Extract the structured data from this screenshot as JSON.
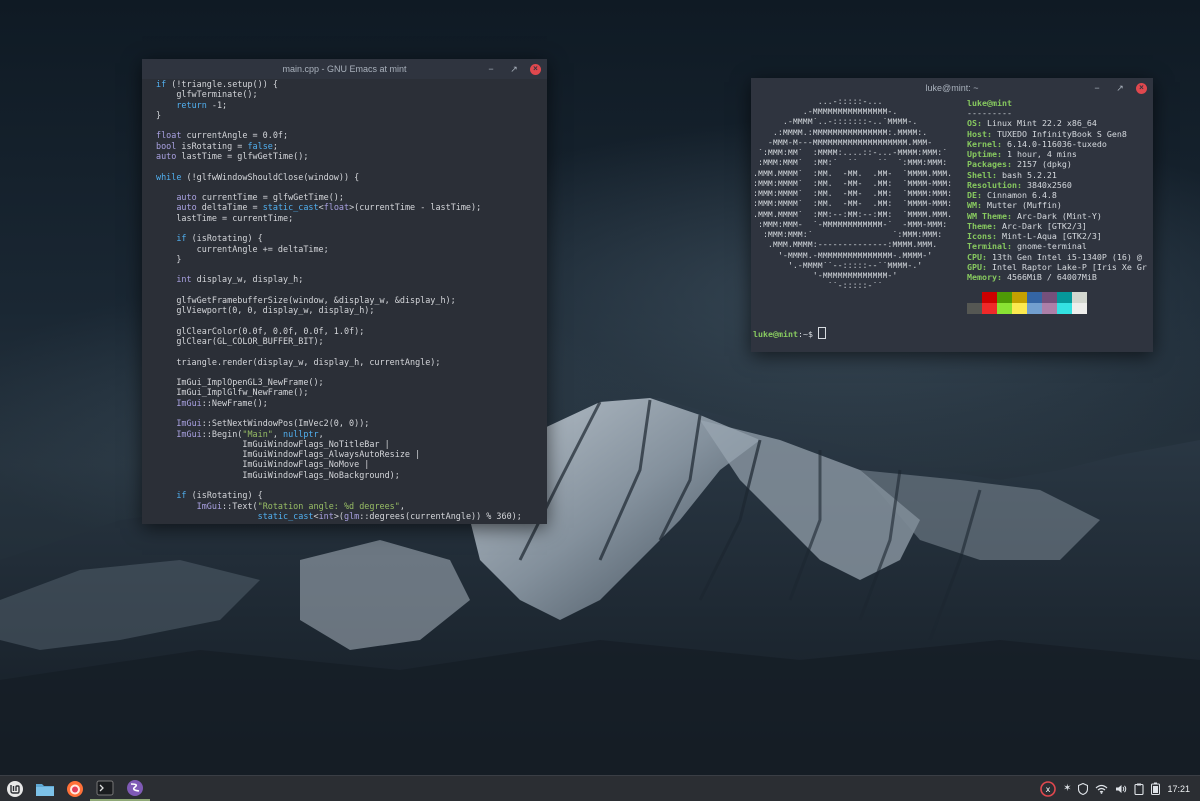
{
  "emacs": {
    "title": "main.cpp - GNU Emacs at mint"
  },
  "terminal": {
    "title": "luke@mint: ~",
    "user_host": "luke@mint",
    "separator": "---------",
    "info": [
      {
        "key": "OS",
        "value": "Linux Mint 22.2 x86_64"
      },
      {
        "key": "Host",
        "value": "TUXEDO InfinityBook S Gen8"
      },
      {
        "key": "Kernel",
        "value": "6.14.0-116036-tuxedo"
      },
      {
        "key": "Uptime",
        "value": "1 hour, 4 mins"
      },
      {
        "key": "Packages",
        "value": "2157 (dpkg)"
      },
      {
        "key": "Shell",
        "value": "bash 5.2.21"
      },
      {
        "key": "Resolution",
        "value": "3840x2560"
      },
      {
        "key": "DE",
        "value": "Cinnamon 6.4.8"
      },
      {
        "key": "WM",
        "value": "Mutter (Muffin)"
      },
      {
        "key": "WM Theme",
        "value": "Arc-Dark (Mint-Y)"
      },
      {
        "key": "Theme",
        "value": "Arc-Dark [GTK2/3]"
      },
      {
        "key": "Icons",
        "value": "Mint-L-Aqua [GTK2/3]"
      },
      {
        "key": "Terminal",
        "value": "gnome-terminal"
      },
      {
        "key": "CPU",
        "value": "13th Gen Intel i5-1340P (16) @"
      },
      {
        "key": "GPU",
        "value": "Intel Raptor Lake-P [Iris Xe Gr"
      },
      {
        "key": "Memory",
        "value": "4566MiB / 64007MiB"
      }
    ],
    "palette_top": [
      "#2f343f",
      "#cc0000",
      "#4e9a06",
      "#c4a000",
      "#3465a4",
      "#75507b",
      "#06989a",
      "#d3d7cf"
    ],
    "palette_bottom": [
      "#555753",
      "#ef2929",
      "#8ae234",
      "#fce94f",
      "#729fcf",
      "#ad7fa8",
      "#34e2e2",
      "#eeeeec"
    ],
    "prompt_user": "luke@mint",
    "prompt_path": ":~$ "
  },
  "taskbar": {
    "items": [
      {
        "name": "mint-menu-button",
        "icon": "linux-mint-logo-icon"
      },
      {
        "name": "files-launcher",
        "icon": "folder-icon"
      },
      {
        "name": "firefox-launcher",
        "icon": "firefox-icon"
      },
      {
        "name": "terminal-launcher",
        "icon": "terminal-icon"
      },
      {
        "name": "emacs-launcher",
        "icon": "emacs-icon"
      }
    ],
    "clock": "17:21"
  },
  "colors": {
    "mint_green": "#87c95f",
    "close_red": "#e0484e",
    "panel": "#2b2e33"
  }
}
